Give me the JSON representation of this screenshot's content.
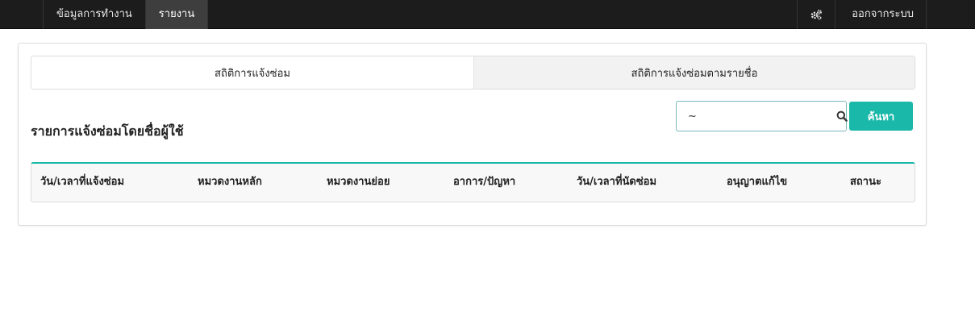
{
  "navbar": {
    "items": [
      {
        "label": "ข้อมูลการทำงาน",
        "active": false
      },
      {
        "label": "รายงาน",
        "active": true
      }
    ],
    "settings_icon": "gears-icon",
    "logout_label": "ออกจากระบบ"
  },
  "tabs": [
    {
      "label": "สถิติการแจ้งซ่อม",
      "active": true
    },
    {
      "label": "สถิติการแจ้งซ่อมตามรายชื่อ",
      "active": false
    }
  ],
  "section": {
    "title": "รายการแจ้งซ่อมโดยชื่อผู้ใช้"
  },
  "search": {
    "value": "~",
    "icon": "search-icon",
    "button_label": "ค้นหา"
  },
  "table": {
    "columns": [
      "วัน/เวลาที่แจ้งซ่อม",
      "หมวดงานหลัก",
      "หมวดงานย่อย",
      "อาการ/ปัญหา",
      "วัน/เวลาที่นัดซ่อม",
      "อนุญาตแก้ไข",
      "สถานะ"
    ],
    "rows": []
  },
  "colors": {
    "navbar_bg": "#1c1c1c",
    "nav_active_bg": "#3e3e3e",
    "accent": "#1ab8a8",
    "search_border": "#7ab8bd"
  }
}
